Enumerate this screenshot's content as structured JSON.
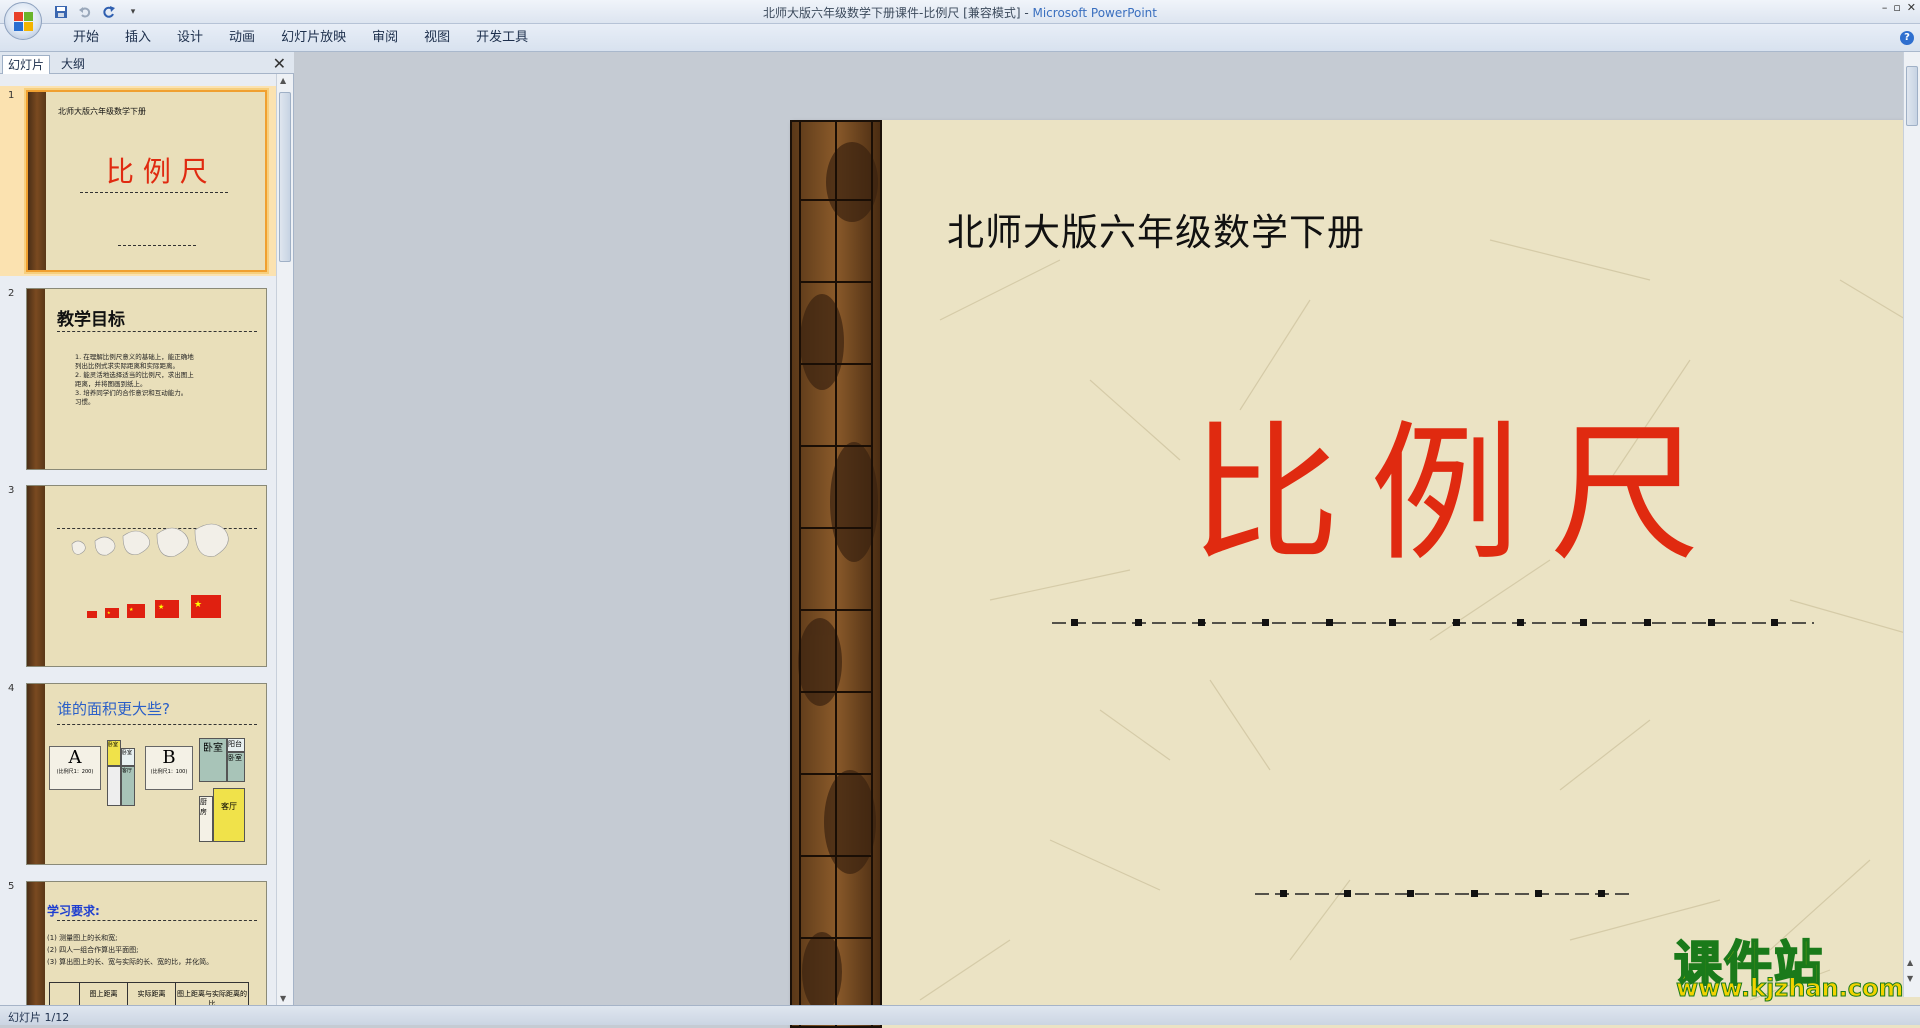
{
  "window": {
    "title": "北师大版六年级数学下册课件-比例尺 [兼容模式] - ",
    "app_name": "Microsoft PowerPoint",
    "controls": [
      "–",
      "▫",
      "✕"
    ]
  },
  "quick_access": [
    {
      "name": "save-icon",
      "glyph": "▪"
    },
    {
      "name": "undo-icon",
      "glyph": "↶"
    },
    {
      "name": "redo-icon",
      "glyph": "↻"
    },
    {
      "name": "customize-icon",
      "glyph": "▾"
    }
  ],
  "ribbon": {
    "tabs": [
      "开始",
      "插入",
      "设计",
      "动画",
      "幻灯片放映",
      "审阅",
      "视图",
      "开发工具"
    ],
    "help": "?"
  },
  "pane": {
    "tab_slides": "幻灯片",
    "tab_outline": "大纲",
    "close": "✕",
    "thumbnails": [
      {
        "num": "1",
        "subtitle": "北师大版六年级数学下册",
        "title": "比 例 尺"
      },
      {
        "num": "2",
        "title": "教学目标",
        "lines": [
          "1. 在理解比例尺意义的基础上，能正确地",
          "列出比例式求实际距离和实际距离。",
          "2. 能灵活地选择适当的比例尺，求出图上",
          "距离，并将图画到纸上。",
          "3. 培养同学们的合作意识和互动能力。",
          "习惯。"
        ]
      },
      {
        "num": "3"
      },
      {
        "num": "4",
        "title": "谁的面积更大些?",
        "labels": [
          "A",
          "B",
          "卧室",
          "卧室",
          "阳台",
          "客厅",
          "厨房",
          "卧室",
          "卧室",
          "客厅",
          "(比例尺1：200)",
          "(比例尺1：100)"
        ]
      },
      {
        "num": "5",
        "title": "学习要求:",
        "lines": [
          "(1) 测量图上的长和宽;",
          "(2) 四人一组合作算出平面图;",
          "(3) 算出图上的长、宽与实际的长、宽的比，并化简。"
        ],
        "table": [
          "图上距离",
          "实际距离",
          "图上距离与实际距离的比"
        ]
      }
    ]
  },
  "slide": {
    "subtitle": "北师大版六年级数学下册",
    "title": "比例尺"
  },
  "watermark": {
    "main": "课件站",
    "url": "www.kjzhan.com"
  },
  "status": {
    "text": "幻灯片 1/12"
  }
}
